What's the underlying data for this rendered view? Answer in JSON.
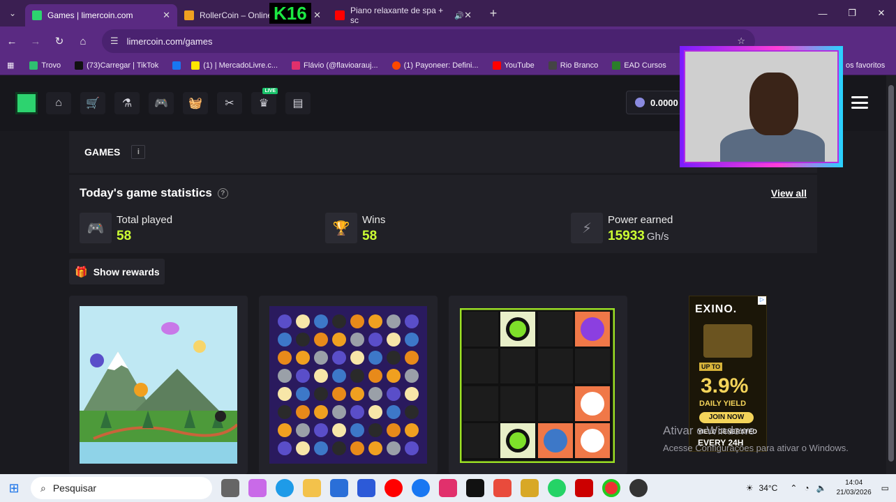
{
  "browser": {
    "tabs": [
      {
        "title": "Games | limercoin.com",
        "active": true,
        "color": "#2dd36f"
      },
      {
        "title": "RollerCoin – Online",
        "active": false,
        "color": "#f0a020"
      },
      {
        "title": "Piano relaxante de spa + sc",
        "active": false,
        "color": "#ff0000"
      }
    ],
    "overlay_text": "K16",
    "url": "limercoin.com/games",
    "bookmarks": [
      {
        "label": "Trovo",
        "color": "#2fbf71"
      },
      {
        "label": "(73)Carregar | TikTok",
        "color": "#111111"
      },
      {
        "label": "(1) | MercadoLivre.c...",
        "color": "#ffe600"
      },
      {
        "label": "Flávio (@flavioarauj...",
        "color": "#e1306c"
      },
      {
        "label": "(1) Payoneer: Defini...",
        "color": "#ff4800"
      },
      {
        "label": "YouTube",
        "color": "#ff0000"
      },
      {
        "label": "Rio Branco",
        "color": "#444444"
      },
      {
        "label": "EAD Cursos",
        "color": "#2a7d2a"
      },
      {
        "label": "os favoritos",
        "color": "#5a2a82"
      }
    ]
  },
  "site": {
    "balance": "0.0000",
    "games_title": "GAMES",
    "info_label": "i",
    "stats_title": "Today's game statistics",
    "view_all": "View all",
    "stats": [
      {
        "label": "Total played",
        "value": "58",
        "unit": ""
      },
      {
        "label": "Wins",
        "value": "58",
        "unit": ""
      },
      {
        "label": "Power earned",
        "value": "15933",
        "unit": "Gh/s"
      }
    ],
    "show_rewards": "Show rewards",
    "live_badge": "LIVE"
  },
  "ad": {
    "brand": "EXINO.",
    "up_to": "UP TO",
    "percent": "3.9%",
    "daily": "DAILY YIELD",
    "join": "JOIN NOW",
    "yield_generated": "YIELD GENERATED",
    "every": "EVERY 24H"
  },
  "windows": {
    "activate_title": "Ativar o Windows",
    "activate_sub": "Acesse Configurações para ativar o Windows.",
    "search_placeholder": "Pesquisar",
    "temperature": "34°C",
    "time": "14:04",
    "date": "21/03/2026"
  }
}
